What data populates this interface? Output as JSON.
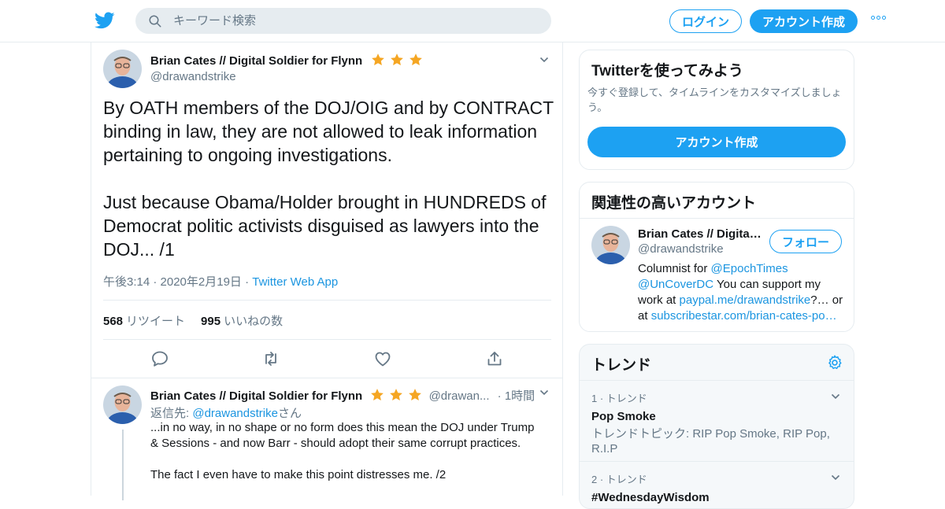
{
  "colors": {
    "accent": "#1da1f2",
    "link": "#1b95e0",
    "star": "#f5a623",
    "muted": "#657786"
  },
  "header": {
    "search_placeholder": "キーワード検索",
    "login_label": "ログイン",
    "signup_label": "アカウント作成"
  },
  "tweet": {
    "author_name": "Brian Cates // Digital Soldier for Flynn",
    "author_handle": "@drawandstrike",
    "text": "By OATH members of the DOJ/OIG and by CONTRACT binding in law, they are not allowed to leak information pertaining to ongoing investigations.\n\nJust because Obama/Holder brought in HUNDREDS of Democrat politic activists disguised as lawyers into the DOJ... /1",
    "time": "午後3:14 · 2020年2月19日 · ",
    "source": "Twitter Web App",
    "retweets": "568",
    "retweets_label": "リツイート",
    "likes": "995",
    "likes_label": "いいねの数"
  },
  "reply": {
    "author_name": "Brian Cates // Digital Soldier for Flynn",
    "author_handle": "@drawan...",
    "time": "· 1時間",
    "reply_to_prefix": "返信先: ",
    "reply_to_handle": "@drawandstrike",
    "reply_to_suffix": "さん",
    "text": "...in no way, in no shape or no form does this mean the DOJ under Trump & Sessions - and now Barr - should adopt their same corrupt practices.\n\nThe fact I even have to make this point distresses me. /2"
  },
  "signup_card": {
    "title": "Twitterを使ってみよう",
    "desc": "今すぐ登録して、タイムラインをカスタマイズしましょう。",
    "button": "アカウント作成"
  },
  "related_card": {
    "title": "関連性の高いアカウント",
    "name": "Brian Cates // Digita…",
    "handle": "@drawandstrike",
    "follow_label": "フォロー",
    "bio_1": "Columnist for ",
    "bio_link_1": "@EpochTimes",
    "bio_link_2": "@UnCoverDC",
    "bio_2": " You can support my work at ",
    "bio_link_3": "paypal.me/drawandstrike",
    "bio_3": "?… or at ",
    "bio_link_4": "subscribestar.com/brian-cates-po…"
  },
  "trends_card": {
    "title": "トレンド",
    "items": [
      {
        "rank": "1 · トレンド",
        "name": "Pop Smoke",
        "desc": "トレンドトピック: RIP Pop Smoke, RIP Pop, R.I.P"
      },
      {
        "rank": "2 · トレンド",
        "name": "#WednesdayWisdom",
        "desc": ""
      }
    ]
  }
}
